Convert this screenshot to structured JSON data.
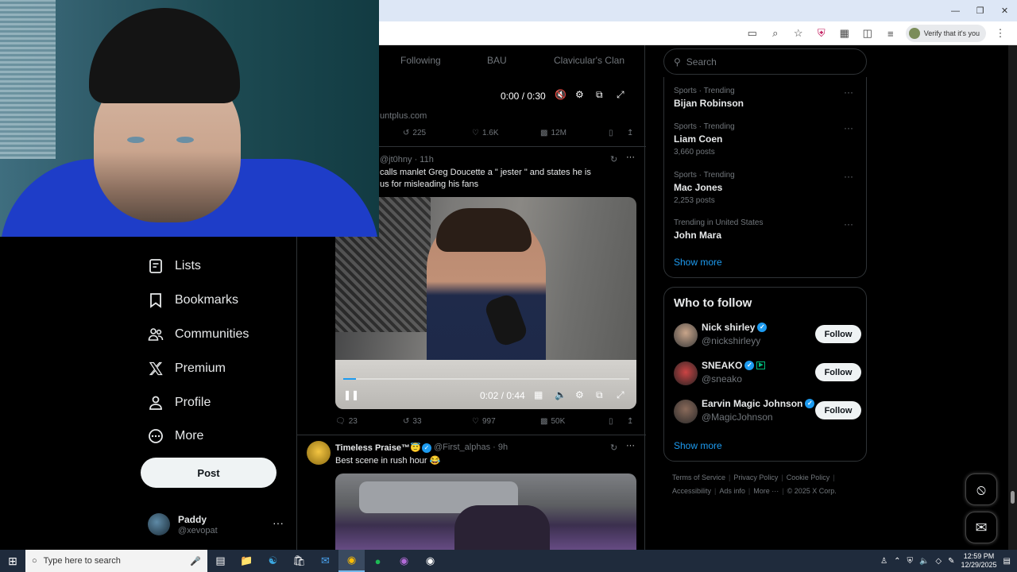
{
  "browser": {
    "verify_label": "Verify that it's you"
  },
  "nav": {
    "items": [
      {
        "label": "Lists",
        "icon": "list-icon"
      },
      {
        "label": "Bookmarks",
        "icon": "bookmark-icon"
      },
      {
        "label": "Communities",
        "icon": "communities-icon"
      },
      {
        "label": "Premium",
        "icon": "x-logo-icon"
      },
      {
        "label": "Profile",
        "icon": "profile-icon"
      },
      {
        "label": "More",
        "icon": "more-circle-icon"
      }
    ],
    "post_label": "Post",
    "account": {
      "name": "Paddy",
      "handle": "@xevopat"
    }
  },
  "feed": {
    "tabs": [
      "Following",
      "BAU",
      "Clavicular's Clan"
    ],
    "video1": {
      "time": "0:00 / 0:30"
    },
    "source": "untplus.com",
    "actions1": {
      "retweets": "225",
      "likes": "1.6K",
      "views": "12M"
    },
    "tweet2": {
      "meta": "@jt0hny · 11h",
      "text_line1": "calls manlet Greg Doucette a \" jester \" and states he is",
      "text_line2": "us for misleading his fans",
      "video_time": "0:02 / 0:44",
      "progress": 0.045
    },
    "actions2": {
      "replies": "23",
      "retweets": "33",
      "likes": "997",
      "views": "50K"
    },
    "tweet3": {
      "name": "Timeless Praise™😇",
      "handle_time": "@First_alphas · 9h",
      "text": "Best scene in rush hour 😂"
    }
  },
  "sidebar": {
    "search_placeholder": "Search",
    "trends": [
      {
        "category": "Sports · Trending",
        "name": "Bijan Robinson",
        "posts": ""
      },
      {
        "category": "Sports · Trending",
        "name": "Liam Coen",
        "posts": "3,660 posts"
      },
      {
        "category": "Sports · Trending",
        "name": "Mac Jones",
        "posts": "2,253 posts"
      },
      {
        "category": "Trending in United States",
        "name": "John Mara",
        "posts": ""
      }
    ],
    "show_more": "Show more",
    "who_to_follow": {
      "title": "Who to follow",
      "follow_label": "Follow",
      "users": [
        {
          "name": "Nick shirley",
          "handle": "@nickshirleyy"
        },
        {
          "name": "SNEAKO",
          "handle": "@sneako"
        },
        {
          "name": "Earvin Magic Johnson",
          "handle": "@MagicJohnson"
        }
      ],
      "show_more": "Show more"
    },
    "footer_line1": [
      "Terms of Service",
      "Privacy Policy",
      "Cookie Policy"
    ],
    "footer_line2": [
      "Accessibility",
      "Ads info",
      "More ···",
      "© 2025 X Corp."
    ]
  },
  "taskbar": {
    "search_placeholder": "Type here to search",
    "time": "12:59 PM",
    "date": "12/29/2025"
  },
  "colors": {
    "accent": "#1d9bf0",
    "background": "#000000",
    "muted": "#71767b"
  }
}
